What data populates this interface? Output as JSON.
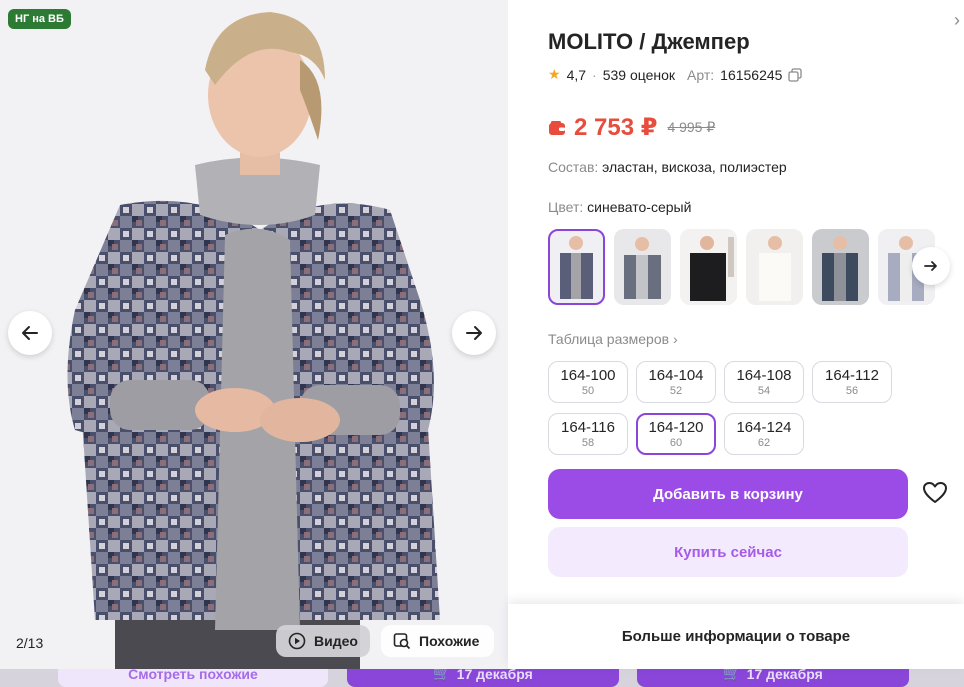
{
  "background": {
    "similar_label": "Смотреть похожие",
    "delivery1": "17 декабря",
    "delivery2": "17 декабря"
  },
  "gallery": {
    "badge": "НГ на ВБ",
    "counter": "2/13",
    "video_label": "Видео",
    "similar_label": "Похожие"
  },
  "product": {
    "title": "MOLITO / Джемпер",
    "rating": "4,7",
    "reviews": "539 оценок",
    "article_label": "Арт:",
    "article": "16156245",
    "price": "2 753 ₽",
    "old_price": "4 995 ₽",
    "composition_label": "Состав:",
    "composition": "эластан, вискоза, полиэстер",
    "color_label": "Цвет:",
    "color": "синевато-серый",
    "size_table_label": "Таблица размеров",
    "sizes": [
      {
        "label": "164-100",
        "ru": "50"
      },
      {
        "label": "164-104",
        "ru": "52"
      },
      {
        "label": "164-108",
        "ru": "54"
      },
      {
        "label": "164-112",
        "ru": "56"
      },
      {
        "label": "164-116",
        "ru": "58"
      },
      {
        "label": "164-120",
        "ru": "60"
      },
      {
        "label": "164-124",
        "ru": "62"
      }
    ],
    "selected_size_index": 5,
    "add_to_cart": "Добавить в корзину",
    "buy_now": "Купить сейчас",
    "more_info": "Больше информации о товаре"
  },
  "colors": {
    "accent": "#9b4be6",
    "price": "#e74c3c",
    "badge": "#2d7a35"
  }
}
